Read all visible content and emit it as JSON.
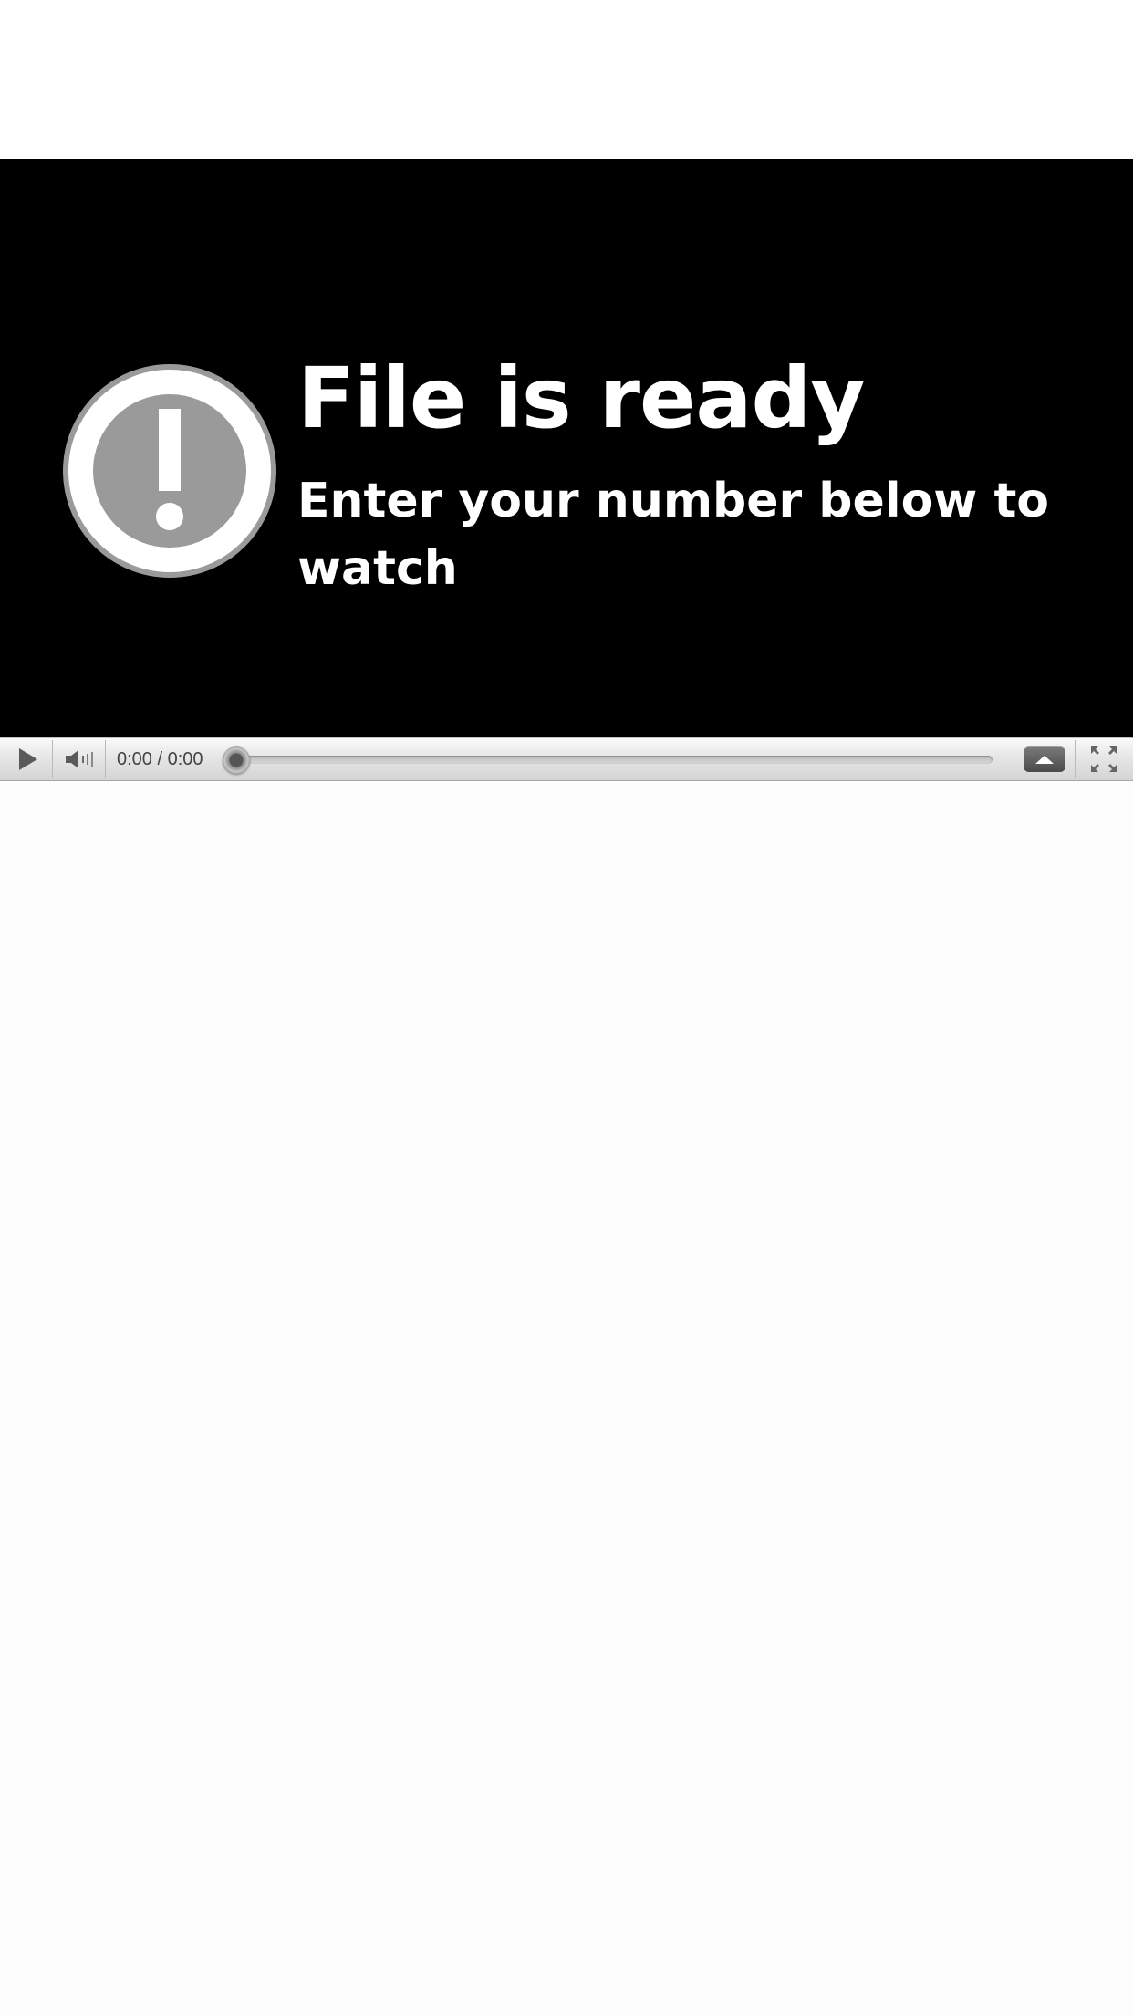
{
  "message": {
    "title": "File is ready",
    "subtitle": "Enter your number below to watch"
  },
  "player": {
    "time": "0:00 / 0:00",
    "progress_fraction": 0,
    "icons": {
      "alert": "exclamation-circle-icon",
      "play": "play-icon",
      "volume": "volume-icon",
      "options": "chevron-up-icon",
      "fullscreen": "fullscreen-icon"
    }
  },
  "colors": {
    "player_background": "#000000",
    "alert_grey": "#9a9a9a",
    "text": "#ffffff"
  }
}
